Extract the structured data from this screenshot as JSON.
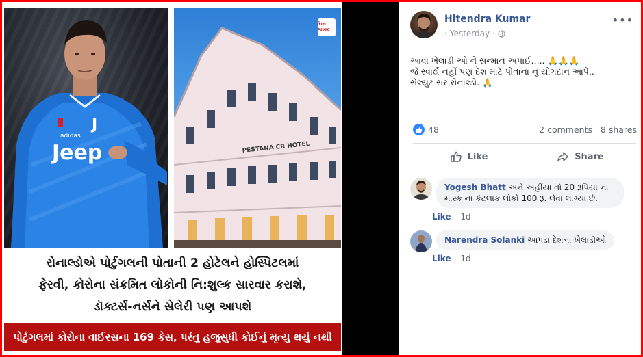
{
  "post": {
    "author": "Hitendra Kumar",
    "time": "Yesterday",
    "privacy_icon": "globe-icon",
    "more_icon": "•••",
    "text_lines": [
      "આવા ખેલાડી ઓ ને સન્માન અપાઈ..... 🙏🙏🙏",
      "જે સ્વાર્થ નહીં પણ દેશ માટે પોતાના નુ યોગદાન આપે..",
      "સેલ્યુટ સર રોનાલ્ડો. 🙏"
    ],
    "like_count": "48",
    "comments_count": "2 comments",
    "shares_count": "8 shares",
    "like_label": "Like",
    "share_label": "Share"
  },
  "image": {
    "hotel_sign": "PESTANA CR HOTEL",
    "badge": "દિવ્ય ભાસ્કર",
    "caption_lines": [
      "રોનાલ્ડોએ પોર્ટુગલની પોતાની 2 હોટેલને હોસ્પિટલમાં",
      "ફેરવી, કોરોના સંક્રમિત લોકોની નિ:શુલ્ક સારવાર કરાશે,",
      "ડૉક્ટર્સ-નર્સને સેલેરી પણ આપશે"
    ],
    "banner": "પોર્ટુગલમાં કોરોના વાઈરસના 169 કેસ, પરંતુ હજુસુધી કોઈનું મૃત્યુ થયું નથી"
  },
  "comments": [
    {
      "name": "Yogesh Bhatt",
      "text_line1": "અને અહીંયા તો 20 રૂપિયા ના",
      "text_line2": "માસ્ક ના કેટલાક લોકો 100 રૂ. લેવા લાગ્યા છે.",
      "like": "Like",
      "time": "1d"
    },
    {
      "name": "Narendra Solanki",
      "text": "આપડા દેશના ખેલાડીઓ",
      "like": "Like",
      "time": "1d"
    }
  ],
  "colors": {
    "outer_border": "#ff0000",
    "fb_link": "#385898",
    "banner_red": "#b50f0f",
    "like_blue": "#2d88ff"
  }
}
